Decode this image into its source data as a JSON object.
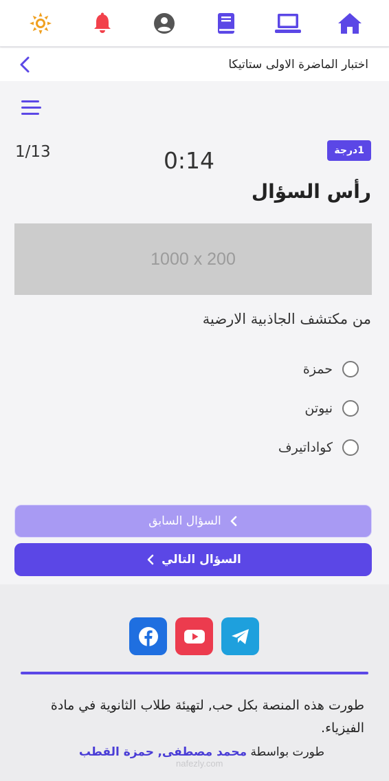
{
  "colors": {
    "accent": "#5b47e6",
    "accent_light": "#a89af3",
    "alert": "#f2414b",
    "sun": "#f0a020",
    "neutral_icon": "#555555"
  },
  "topnav": {
    "icons": [
      "sun-icon",
      "bell-icon",
      "account-icon",
      "book-icon",
      "laptop-icon",
      "home-icon"
    ]
  },
  "header": {
    "title": "اختبار الماضرة الاولى ستاتيكا"
  },
  "quiz": {
    "counter": "1/13",
    "timer": "0:14",
    "points_badge": "1درجة",
    "question_head": "رأس السؤال",
    "image_placeholder": "1000 x 200",
    "question_text": "من مكتشف الجاذبية الارضية",
    "options": [
      {
        "label": "حمزة",
        "selected": false
      },
      {
        "label": "نيوتن",
        "selected": false
      },
      {
        "label": "كواداتيرف",
        "selected": false
      }
    ],
    "prev_label": "السؤال السابق",
    "next_label": "السؤال التالي"
  },
  "footer": {
    "socials": [
      "facebook-icon",
      "youtube-icon",
      "telegram-icon"
    ],
    "about": "طورت هذه المنصة بكل حب, لتهيئة طلاب الثانوية في مادة الفيزياء.",
    "credits_prefix": "طورت بواسطة",
    "author_1": "محمد مصطفى",
    "separator": ",",
    "author_2": "حمزة القطب",
    "watermark": "nafezly.com"
  }
}
